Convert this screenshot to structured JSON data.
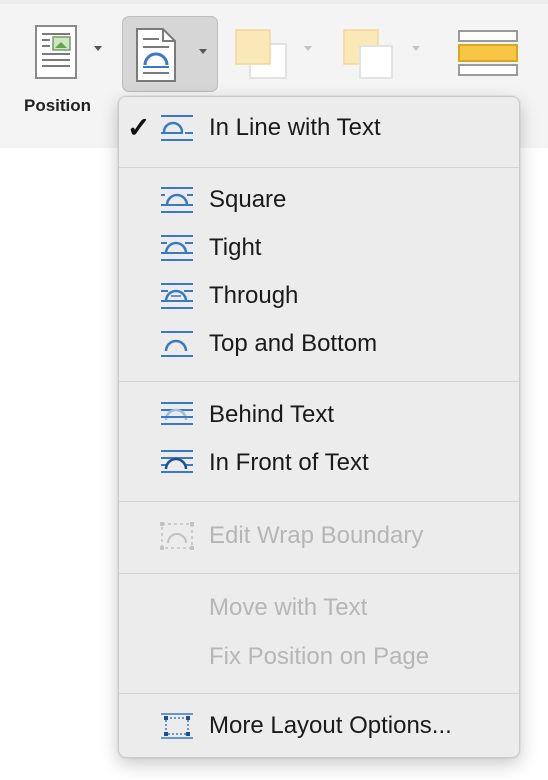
{
  "ribbon": {
    "position_label": "Position"
  },
  "menu": {
    "items": [
      {
        "label": "In Line with Text",
        "icon": "wrap-inline-icon",
        "checked": true,
        "disabled": false
      },
      {
        "label": "Square",
        "icon": "wrap-square-icon",
        "checked": false,
        "disabled": false
      },
      {
        "label": "Tight",
        "icon": "wrap-tight-icon",
        "checked": false,
        "disabled": false
      },
      {
        "label": "Through",
        "icon": "wrap-through-icon",
        "checked": false,
        "disabled": false
      },
      {
        "label": "Top and Bottom",
        "icon": "wrap-top-bottom-icon",
        "checked": false,
        "disabled": false
      },
      {
        "label": "Behind Text",
        "icon": "wrap-behind-icon",
        "checked": false,
        "disabled": false
      },
      {
        "label": "In Front of Text",
        "icon": "wrap-front-icon",
        "checked": false,
        "disabled": false
      },
      {
        "label": "Edit Wrap Boundary",
        "icon": "edit-boundary-icon",
        "checked": false,
        "disabled": true
      },
      {
        "label": "Move with Text",
        "checked": false,
        "disabled": true
      },
      {
        "label": "Fix Position on Page",
        "checked": false,
        "disabled": true
      },
      {
        "label": "More Layout Options...",
        "icon": "layout-options-icon",
        "checked": false,
        "disabled": false
      }
    ],
    "check_glyph": "✓"
  },
  "colors": {
    "icon_blue": "#3a78c8",
    "accent_yellow": "#f6c644"
  }
}
